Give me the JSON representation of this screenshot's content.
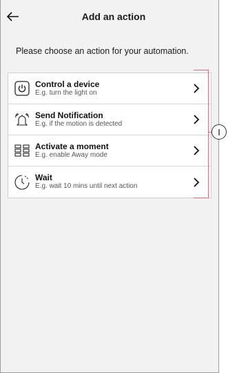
{
  "header": {
    "title": "Add an action"
  },
  "intro_text": "Please choose an action for your automation.",
  "actions": [
    {
      "title": "Control a device",
      "subtitle": "E.g. turn the light on",
      "icon": "power-icon"
    },
    {
      "title": "Send Notification",
      "subtitle": "E.g. if the motion is detected",
      "icon": "bell-icon"
    },
    {
      "title": "Activate a moment",
      "subtitle": "E.g. enable Away mode",
      "icon": "moment-grid-icon"
    },
    {
      "title": "Wait",
      "subtitle": "E.g. wait 10 mins until next action",
      "icon": "timer-icon"
    }
  ],
  "callout": {
    "label": "I"
  },
  "colors": {
    "background": "#f2f2f2",
    "callout_bracket": "#e36b7f"
  }
}
